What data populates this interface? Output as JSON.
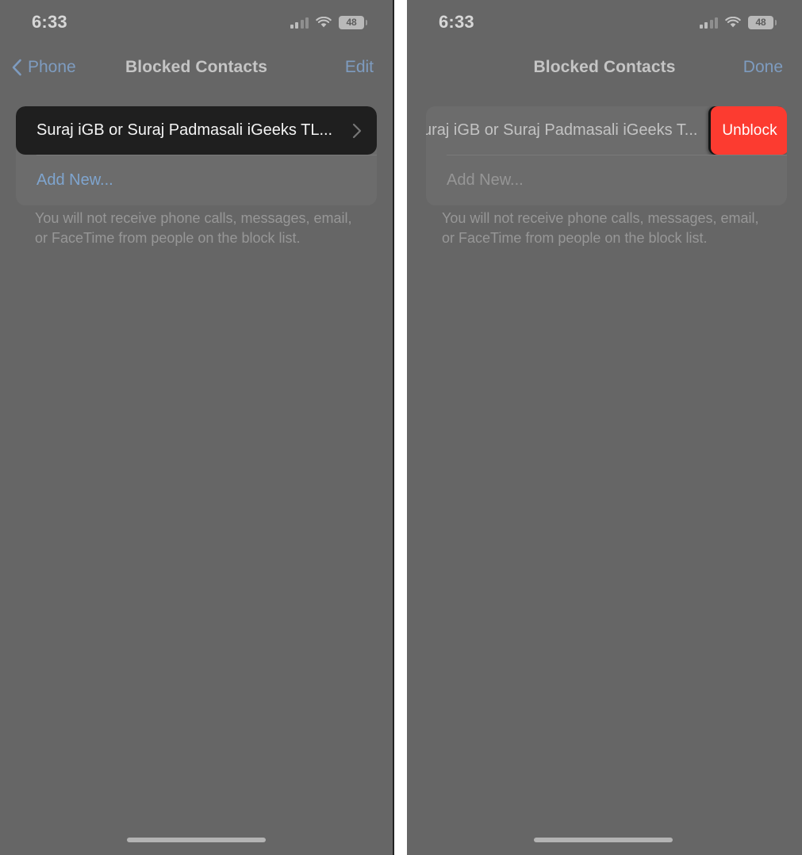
{
  "screens": [
    {
      "id": "left",
      "status_bar": {
        "time": "6:33",
        "cellular_icon": "cellular-signal-icon",
        "wifi_icon": "wifi-icon",
        "battery_level": "48",
        "battery_icon": "battery-icon"
      },
      "nav_bar": {
        "back_label": "Phone",
        "back_icon": "chevron-left-icon",
        "title": "Blocked Contacts",
        "action_label": "Edit"
      },
      "list": {
        "contact_row": {
          "label": "Suraj iGB or Suraj Padmasali iGeeks TL...",
          "disclosure_icon": "chevron-right-icon",
          "highlighted": true
        },
        "add_row": {
          "label": "Add New..."
        }
      },
      "footnote": "You will not receive phone calls, messages, email, or FaceTime from people on the block list.",
      "home_indicator": "home-indicator"
    },
    {
      "id": "right",
      "status_bar": {
        "time": "6:33",
        "cellular_icon": "cellular-signal-icon",
        "wifi_icon": "wifi-icon",
        "battery_level": "48",
        "battery_icon": "battery-icon"
      },
      "nav_bar": {
        "title": "Blocked Contacts",
        "action_label": "Done"
      },
      "list": {
        "contact_row": {
          "label": "uraj iGB or Suraj Padmasali iGeeks T...",
          "swiped": true,
          "swipe_action_label": "Unblock"
        },
        "add_row": {
          "label": "Add New..."
        }
      },
      "footnote": "You will not receive phone calls, messages, email, or FaceTime from people on the block list.",
      "home_indicator": "home-indicator"
    }
  ],
  "colors": {
    "destructive_red": "#FC3B30",
    "link_blue": "#7FA5CF",
    "panel_background": "#666666",
    "card_background": "#6C6C6C",
    "highlight_row": "#1F1F1F"
  }
}
